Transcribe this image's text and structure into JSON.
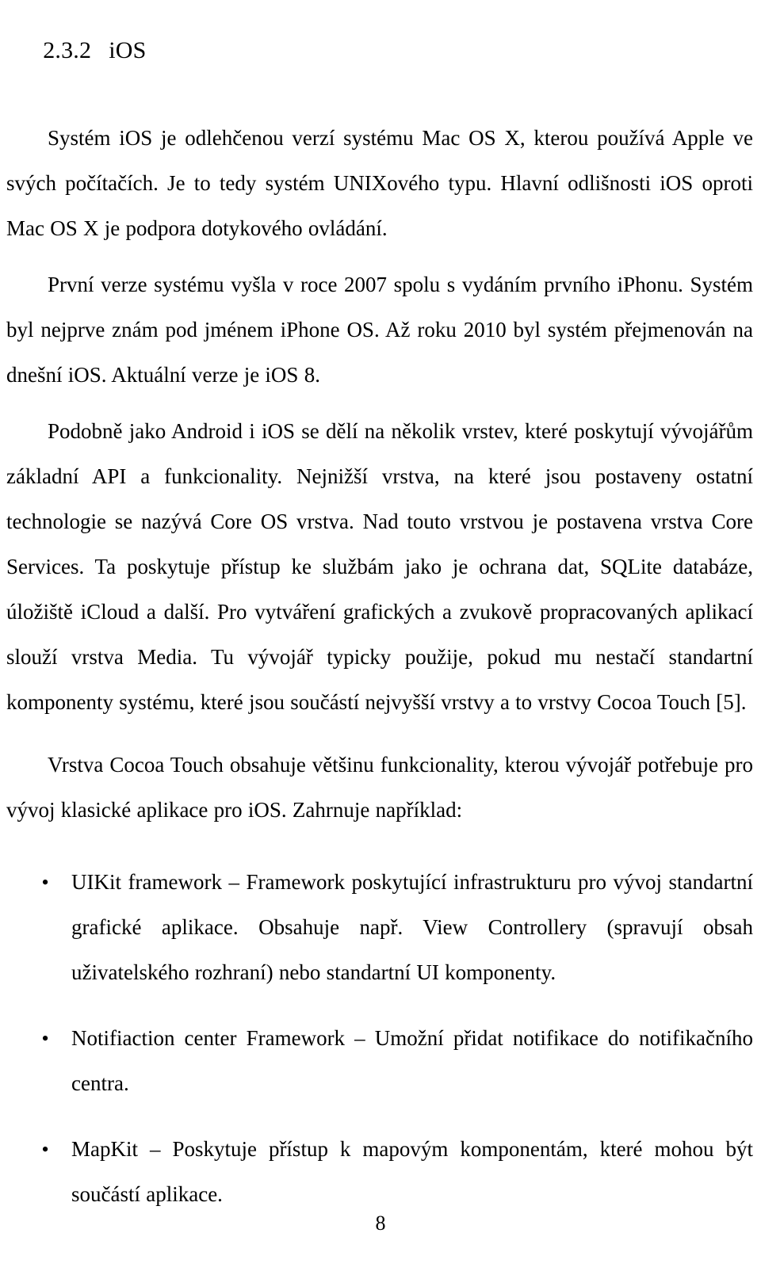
{
  "document": {
    "language": "cs",
    "background_color": "#ffffff",
    "text_color": "#000000"
  },
  "heading": {
    "number": "2.3.2",
    "title": "iOS"
  },
  "paragraphs": [
    {
      "id": "para-intro",
      "text": "Systém iOS je odlehčenou verzí systému Mac OS X, kterou používá Apple ve svých počítačích. Je to tedy systém UNIXového typu. Hlavní odlišnosti iOS oproti Mac OS X je podpora dotykového ovládání."
    },
    {
      "id": "para-history",
      "text": "První verze systému vyšla v roce 2007 spolu s vydáním prvního iPhonu. Systém byl nejprve znám pod jménem iPhone OS. Až roku 2010 byl systém přejmenován na dnešní iOS. Aktuální verze je iOS 8."
    },
    {
      "id": "para-layers",
      "text": "Podobně jako Android i iOS se dělí na několik vrstev, které poskytují vývojářům základní API a funkcionality. Nejnižší vrstva, na které jsou postaveny ostatní technologie se nazývá Core OS vrstva. Nad touto vrstvou je postavena vrstva Core Services. Ta poskytuje přístup ke službám jako je ochrana dat, SQLite databáze, úložiště iCloud a další. Pro vytváření grafických a zvukově propracovaných aplikací slouží vrstva Media. Tu vývojář typicky použije, pokud mu nestačí standartní komponenty systému, které jsou součástí nejvyšší vrstvy a to vrstvy Cocoa Touch [5]."
    },
    {
      "id": "para-cocoa",
      "text": "Vrstva Cocoa Touch obsahuje většinu funkcionality, kterou vývojář potřebuje pro vývoj klasické aplikace pro iOS. Zahrnuje například:"
    }
  ],
  "bullet_list": {
    "marker": "•",
    "items": [
      {
        "id": "bullet-uikit",
        "text": "UIKit framework – Framework poskytující infrastrukturu pro vývoj standartní grafické aplikace. Obsahuje např. View Controllery (spravují obsah uživatelského rozhraní) nebo standartní UI komponenty."
      },
      {
        "id": "bullet-notification-center",
        "text": "Notifiaction center Framework – Umožní přidat notifikace do notifikačního centra."
      },
      {
        "id": "bullet-mapkit",
        "text": "MapKit – Poskytuje přístup k mapovým komponentám, které mohou být součástí aplikace."
      }
    ]
  },
  "footer": {
    "page_number": "8"
  }
}
